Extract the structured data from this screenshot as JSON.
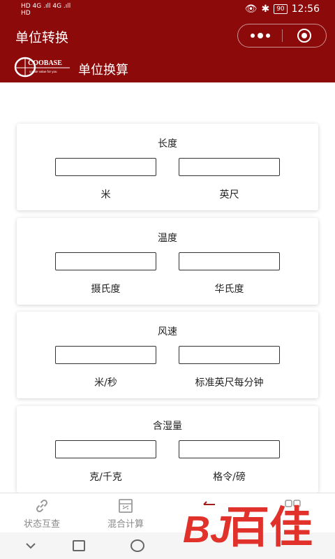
{
  "statusbar": {
    "signal_line1": "HD 4G .ıll 4G .ıll",
    "signal_line2": "HD",
    "battery": "90",
    "time": "12:56"
  },
  "titlebar": {
    "title": "单位转换",
    "more_icon": "more-dots-icon",
    "close_icon": "target-close-icon"
  },
  "brand": {
    "logo_text": "COOBASE",
    "logo_tagline": "create value for you",
    "title": "单位换算"
  },
  "converters": [
    {
      "title": "长度",
      "left_unit": "米",
      "right_unit": "英尺",
      "left_value": "",
      "right_value": ""
    },
    {
      "title": "温度",
      "left_unit": "摄氏度",
      "right_unit": "华氏度",
      "left_value": "",
      "right_value": ""
    },
    {
      "title": "风速",
      "left_unit": "米/秒",
      "right_unit": "标准英尺每分钟",
      "left_value": "",
      "right_value": ""
    },
    {
      "title": "含湿量",
      "left_unit": "克/千克",
      "right_unit": "格令/磅",
      "left_value": "",
      "right_value": ""
    }
  ],
  "tabbar": {
    "tabs": [
      {
        "label": "状态互查",
        "icon": "link-icon"
      },
      {
        "label": "混合计算",
        "icon": "calculator-icon"
      },
      {
        "label": "",
        "icon": "arrow-icon"
      },
      {
        "label": "",
        "icon": "grid-icon"
      }
    ]
  },
  "watermark": {
    "text": "百佳",
    "brand": "BJ"
  },
  "colors": {
    "brand_red": "#8d0a0a",
    "watermark_red": "#e0312a"
  }
}
